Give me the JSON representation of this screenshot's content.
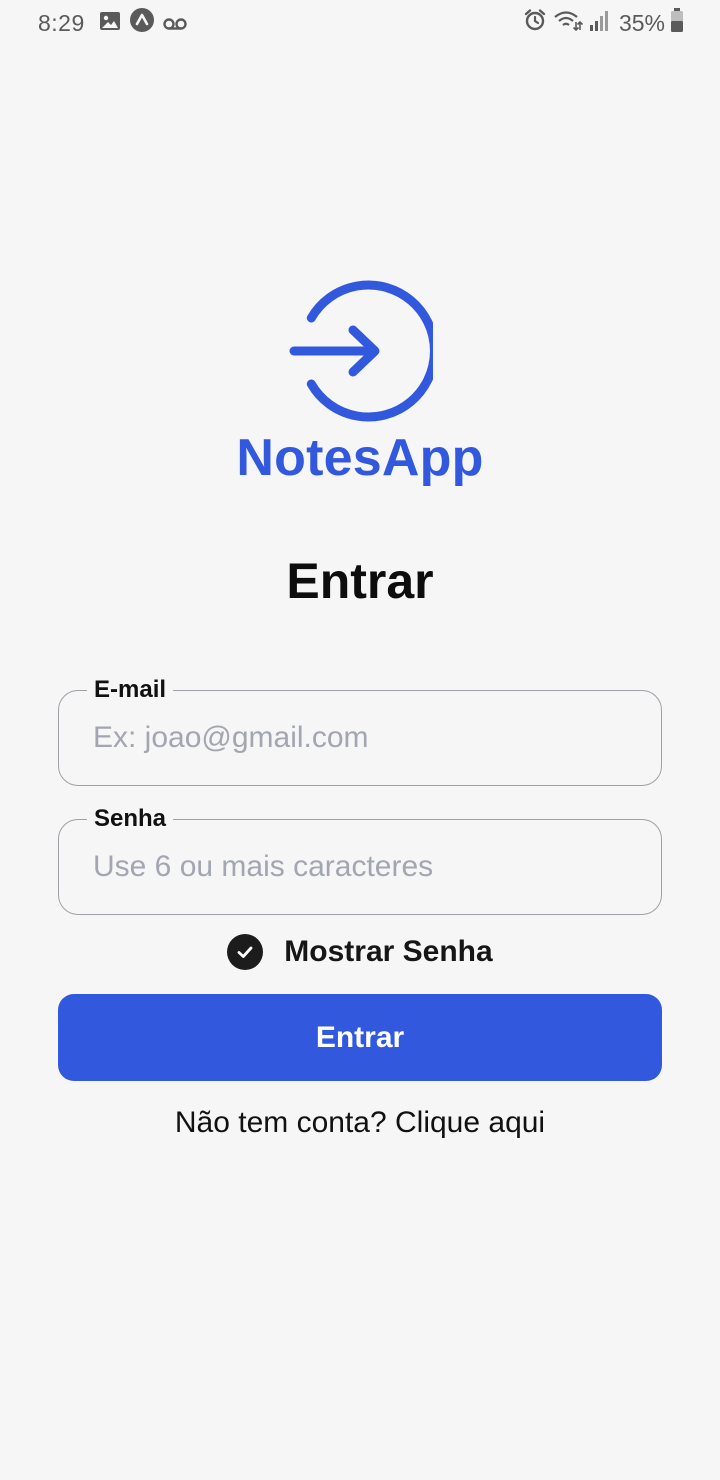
{
  "status_bar": {
    "time": "8:29",
    "battery": "35%",
    "icons_left": [
      "image-icon",
      "app-notification-icon",
      "voicemail-icon"
    ],
    "icons_right": [
      "alarm-icon",
      "wifi-icon",
      "signal-icon",
      "battery-icon"
    ]
  },
  "app": {
    "name": "NotesApp",
    "logo_icon": "login-arrow-icon",
    "brand_color": "#3158dd"
  },
  "page": {
    "title": "Entrar"
  },
  "form": {
    "email": {
      "label": "E-mail",
      "placeholder": "Ex: joao@gmail.com",
      "value": ""
    },
    "password": {
      "label": "Senha",
      "placeholder": "Use 6 ou mais caracteres",
      "value": ""
    },
    "show_password": {
      "label": "Mostrar Senha",
      "checked": true
    },
    "submit_label": "Entrar"
  },
  "footer": {
    "signup_text": "Não tem conta? Clique aqui"
  }
}
